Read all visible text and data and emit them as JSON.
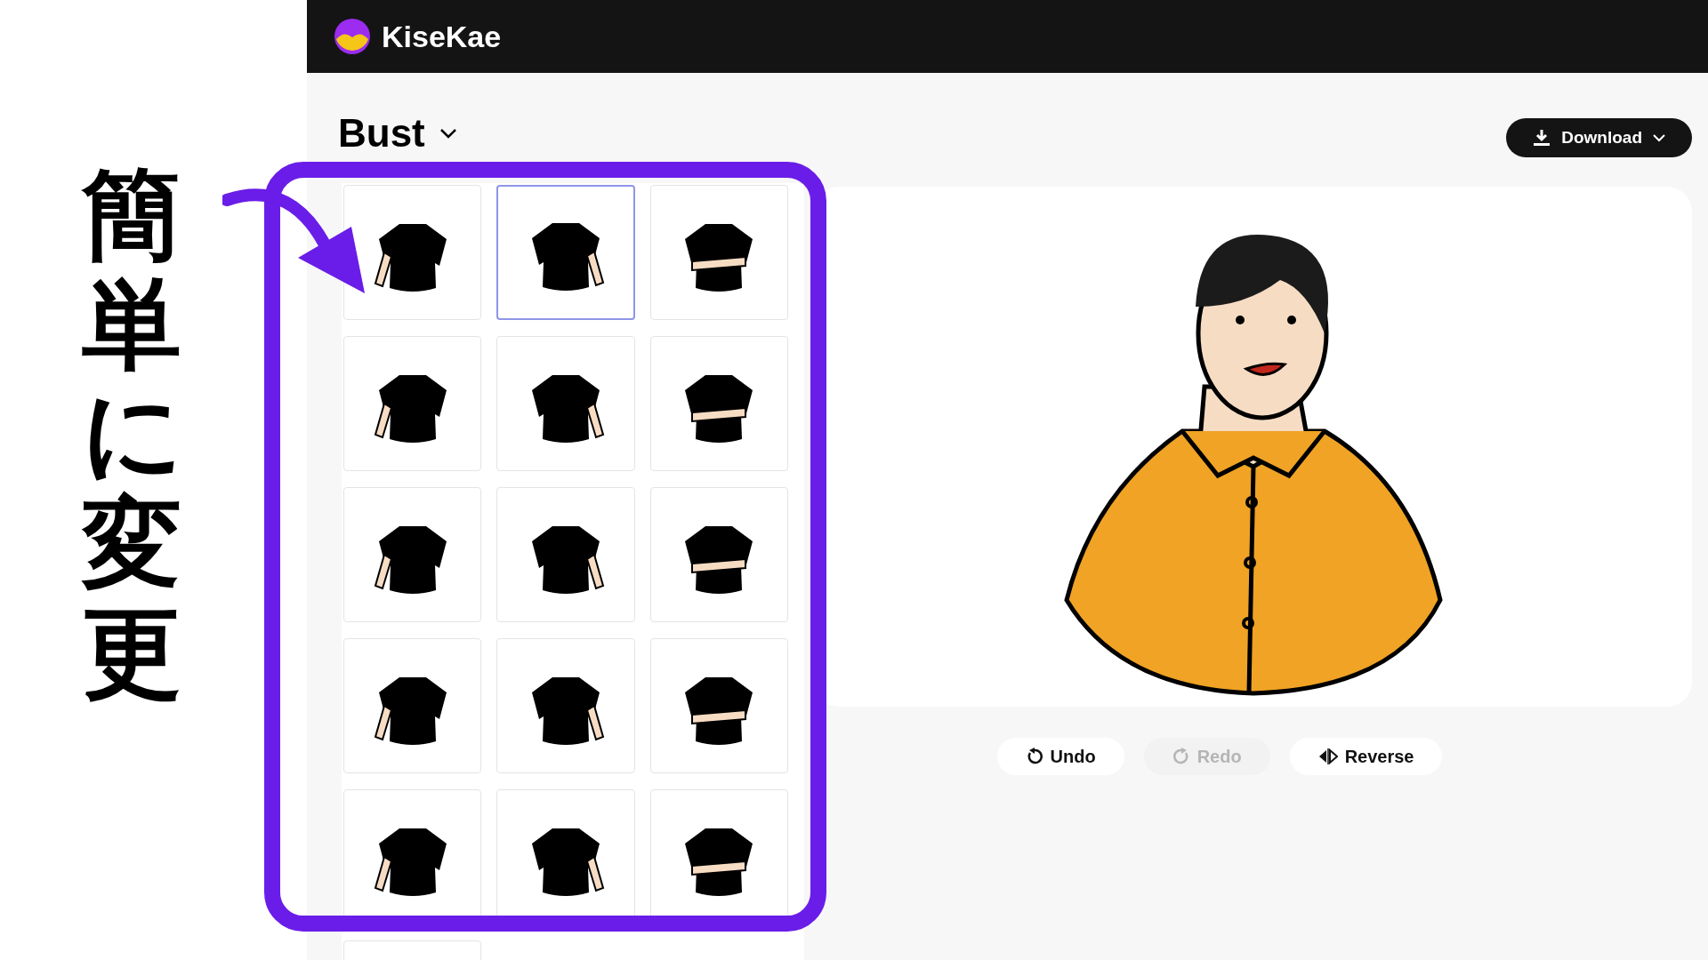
{
  "caption": "簡単に変更",
  "header": {
    "app_name": "KiseKae"
  },
  "category": {
    "label": "Bust"
  },
  "download_button": {
    "label": "Download"
  },
  "poses": [
    {
      "selected": false
    },
    {
      "selected": true
    },
    {
      "selected": false
    },
    {
      "selected": false
    },
    {
      "selected": false
    },
    {
      "selected": false
    },
    {
      "selected": false
    },
    {
      "selected": false
    },
    {
      "selected": false
    },
    {
      "selected": false
    },
    {
      "selected": false
    },
    {
      "selected": false
    },
    {
      "selected": false
    },
    {
      "selected": false
    },
    {
      "selected": false
    },
    {
      "selected": false
    }
  ],
  "actions": [
    {
      "kind": "undo",
      "label": "Undo",
      "disabled": false
    },
    {
      "kind": "redo",
      "label": "Redo",
      "disabled": true
    },
    {
      "kind": "reverse",
      "label": "Reverse",
      "disabled": false
    }
  ]
}
